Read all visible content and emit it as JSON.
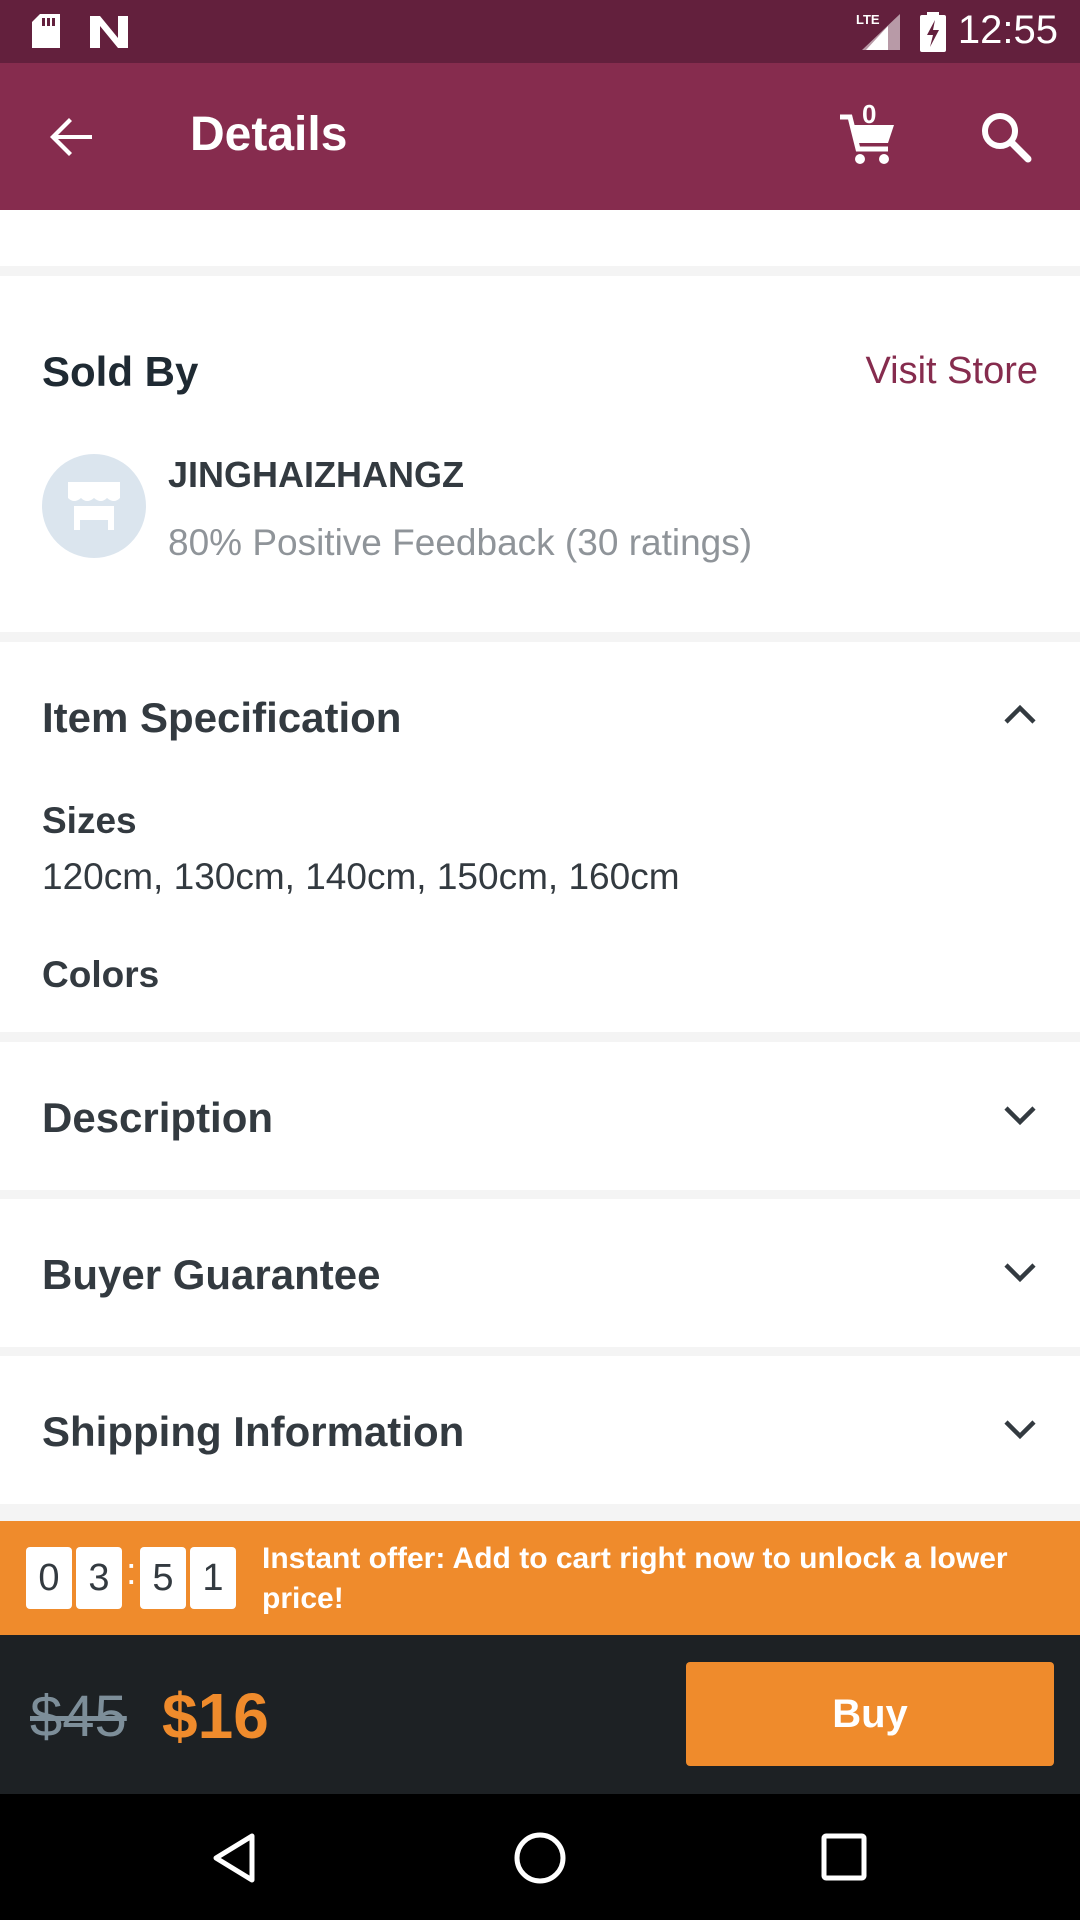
{
  "status_bar": {
    "time": "12:55",
    "network": "LTE"
  },
  "app_bar": {
    "title": "Details",
    "cart_count": "0"
  },
  "seller": {
    "heading": "Sold By",
    "visit_store": "Visit Store",
    "name": "JINGHAIZHANGZ",
    "feedback": "80% Positive Feedback (30 ratings)"
  },
  "item_spec": {
    "title": "Item Specification",
    "sizes_label": "Sizes",
    "sizes_value": "120cm, 130cm, 140cm, 150cm, 160cm",
    "colors_label": "Colors"
  },
  "sections": {
    "description": "Description",
    "buyer_guarantee": "Buyer Guarantee",
    "shipping_information": "Shipping Information"
  },
  "offer": {
    "timer": {
      "d1": "0",
      "d2": "3",
      "d3": "5",
      "d4": "1",
      "separator": ":"
    },
    "message": "Instant offer: Add to cart right now to unlock a lower price!"
  },
  "price": {
    "original": "$45",
    "current": "$16"
  },
  "buy_button": "Buy",
  "colors": {
    "brand": "#862c4e",
    "status_bar": "#63203d",
    "accent": "#ef8b2c",
    "bottom_bar": "#1d2124"
  }
}
